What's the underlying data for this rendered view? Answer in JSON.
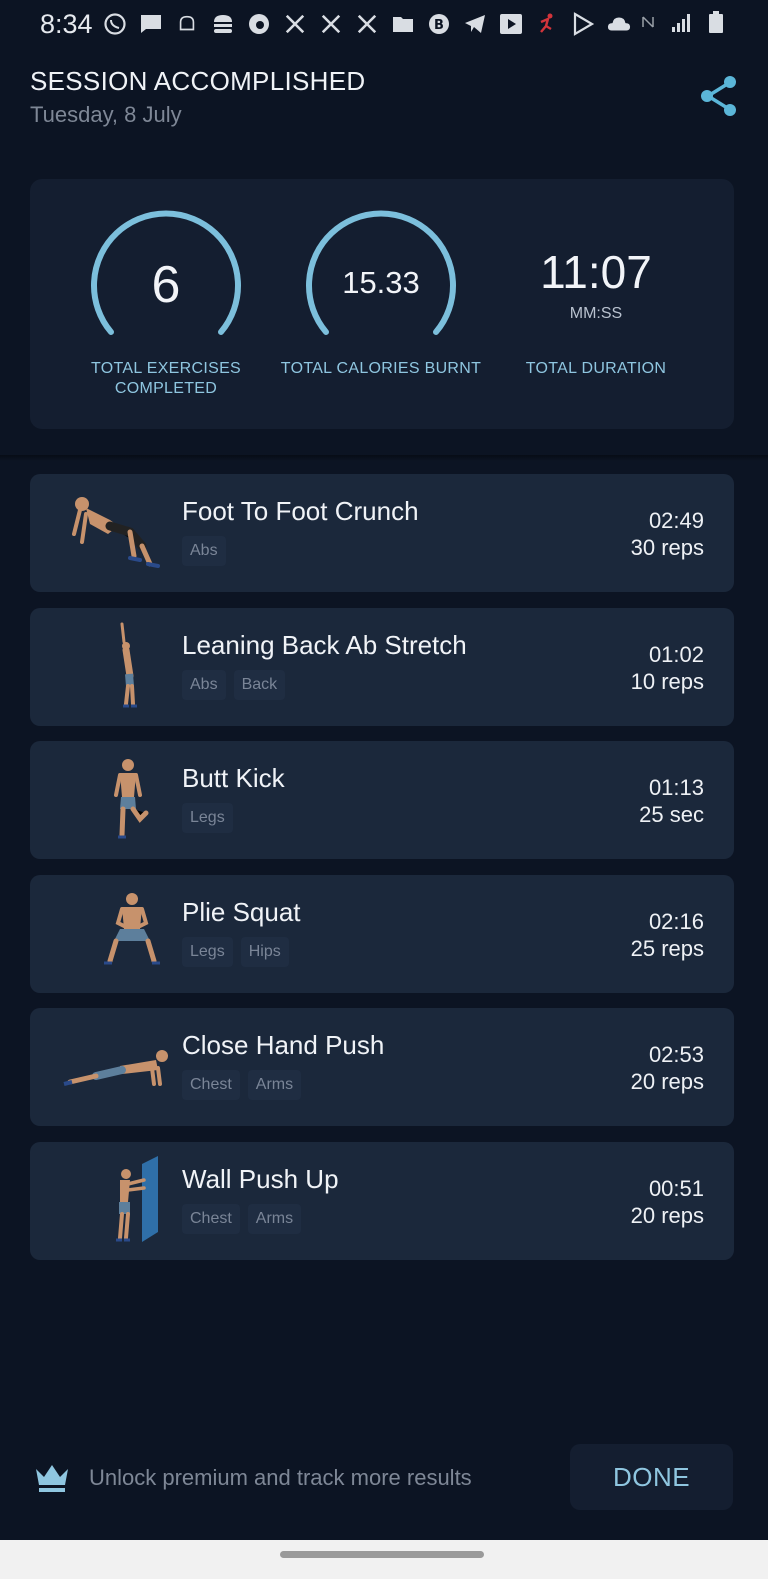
{
  "status_bar": {
    "time": "8:34",
    "icons": [
      "whatsapp-icon",
      "message-icon",
      "chef-icon",
      "burger-icon",
      "edge-icon",
      "x-icon",
      "x-icon",
      "x-icon",
      "folder-icon",
      "bitcoin-icon",
      "telegram-icon",
      "youtube-icon",
      "runner-icon",
      "play-store-icon",
      "cloud-icon"
    ],
    "right_icons": [
      "nfc-icon",
      "signal-icon",
      "battery-icon"
    ]
  },
  "header": {
    "title": "SESSION ACCOMPLISHED",
    "date": "Tuesday, 8 July"
  },
  "stats": {
    "exercises": {
      "value": "6",
      "label": "TOTAL EXERCISES COMPLETED"
    },
    "calories": {
      "value": "15.33",
      "label": "TOTAL CALORIES BURNT"
    },
    "duration": {
      "value": "11:07",
      "unit": "MM:SS",
      "label": "TOTAL DURATION"
    }
  },
  "exercises": [
    {
      "name": "Foot To Foot Crunch",
      "tags": [
        "Abs"
      ],
      "duration": "02:49",
      "amount": "30 reps"
    },
    {
      "name": "Leaning Back Ab Stretch",
      "tags": [
        "Abs",
        "Back"
      ],
      "duration": "01:02",
      "amount": "10 reps"
    },
    {
      "name": "Butt Kick",
      "tags": [
        "Legs"
      ],
      "duration": "01:13",
      "amount": "25 sec"
    },
    {
      "name": "Plie Squat",
      "tags": [
        "Legs",
        "Hips"
      ],
      "duration": "02:16",
      "amount": "25 reps"
    },
    {
      "name": "Close Hand Push",
      "tags": [
        "Chest",
        "Arms"
      ],
      "duration": "02:53",
      "amount": "20 reps"
    },
    {
      "name": "Wall Push Up",
      "tags": [
        "Chest",
        "Arms"
      ],
      "duration": "00:51",
      "amount": "20 reps"
    }
  ],
  "footer": {
    "premium_text": "Unlock premium and track more results",
    "done_label": "DONE"
  },
  "colors": {
    "background": "#0c1423",
    "card": "#1b283b",
    "accent": "#8fc6e0"
  }
}
